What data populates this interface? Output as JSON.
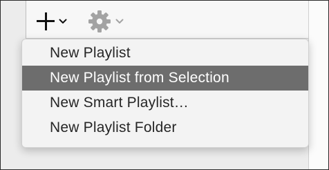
{
  "toolbar": {
    "add_icon": "plus-icon",
    "add_chevron_icon": "chevron-down-icon",
    "gear_icon": "gear-icon",
    "gear_chevron_icon": "chevron-down-icon"
  },
  "menu": {
    "items": [
      {
        "label": "New Playlist",
        "selected": false
      },
      {
        "label": "New Playlist from Selection",
        "selected": true
      },
      {
        "label": "New Smart Playlist…",
        "selected": false
      },
      {
        "label": "New Playlist Folder",
        "selected": false
      }
    ],
    "highlight_color": "#6d6d6d"
  }
}
